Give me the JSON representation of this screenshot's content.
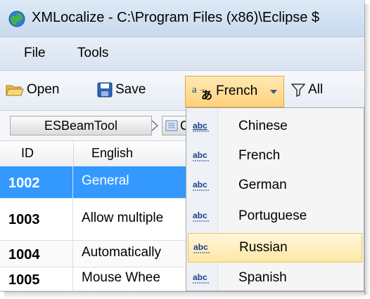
{
  "window": {
    "title": "XMLocalize - C:\\Program Files (x86)\\Eclipse $"
  },
  "menu": {
    "file": "File",
    "tools": "Tools"
  },
  "toolbar": {
    "open": "Open",
    "save": "Save",
    "language": "French",
    "filter": "All"
  },
  "breadcrumb": {
    "root": "ESBeamTool"
  },
  "grid": {
    "columns": [
      "ID",
      "English"
    ],
    "rows": [
      {
        "id": "1002",
        "english": "General"
      },
      {
        "id": "1003",
        "english": "Allow multiple"
      },
      {
        "id": "1004",
        "english": "Automatically"
      },
      {
        "id": "1005",
        "english": "Mouse Whee"
      }
    ]
  },
  "language_menu": {
    "icon_text": "abc",
    "items": [
      "Chinese",
      "French",
      "German",
      "Portuguese",
      "Russian",
      "Spanish"
    ],
    "highlighted": "Russian"
  },
  "colors": {
    "selection": "#3399ff",
    "highlight": "#ffe8a6",
    "toolbar_active": "#ffd17a"
  }
}
